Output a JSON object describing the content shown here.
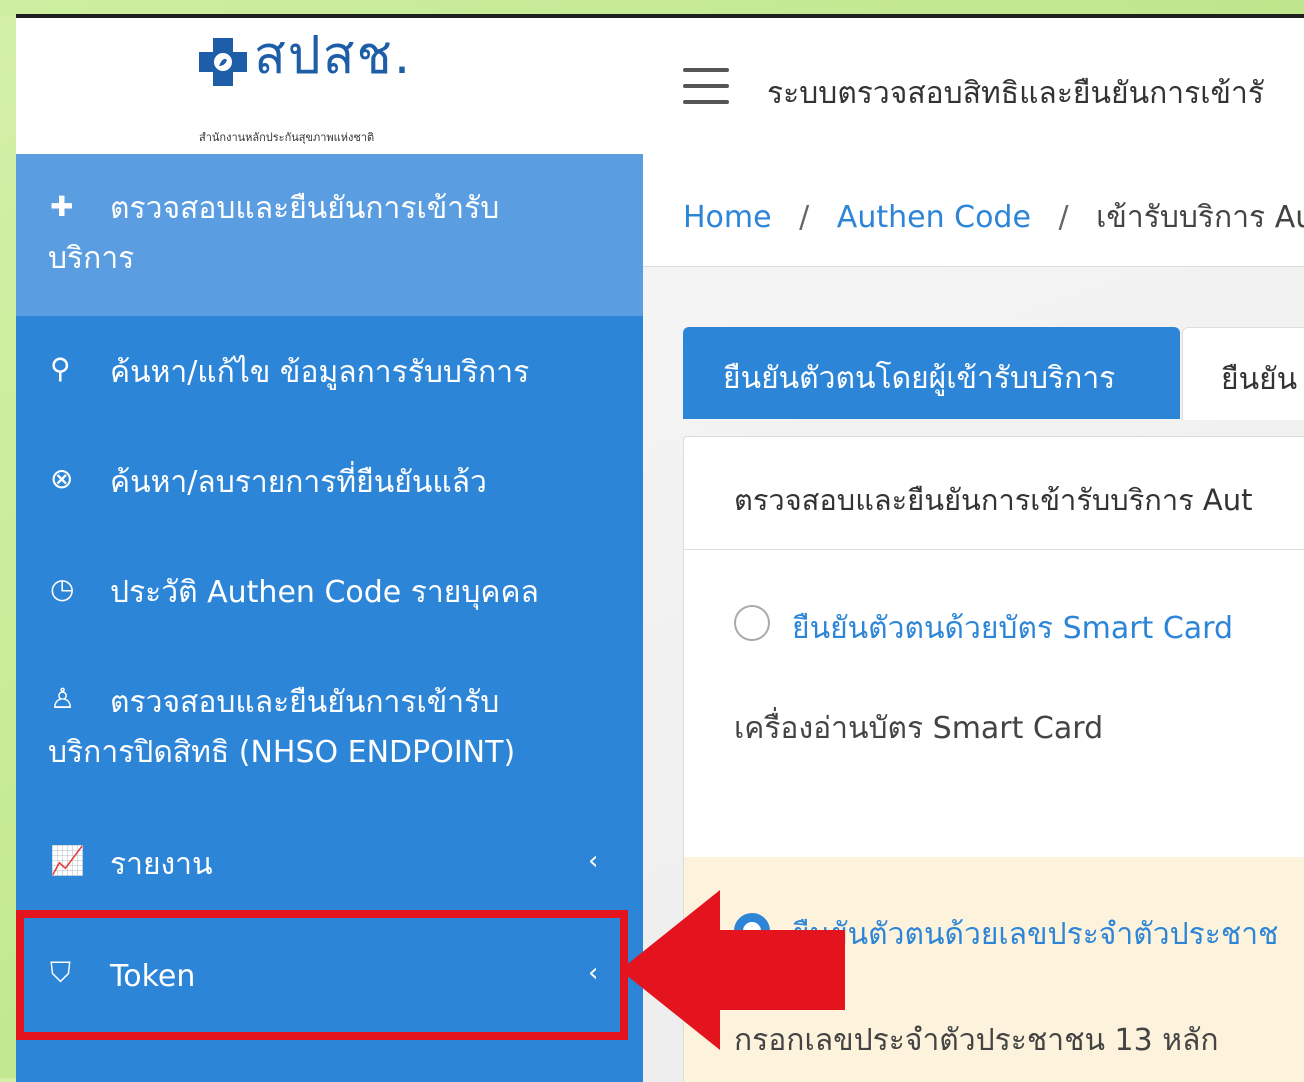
{
  "header": {
    "logo_text": "สปสช.",
    "logo_subtext": "สำนักงานหลักประกันสุขภาพแห่งชาติ",
    "system_title": "ระบบตรวจสอบสิทธิและยืนยันการเข้ารั"
  },
  "sidebar": {
    "items": [
      {
        "icon": "plus-outline-icon",
        "label_line1": "ตรวจสอบและยืนยันการเข้ารับ",
        "label_line2": "บริการ"
      },
      {
        "icon": "search-icon",
        "label": "ค้นหา/แก้ไข ข้อมูลการรับบริการ"
      },
      {
        "icon": "close-circle-icon",
        "label": "ค้นหา/ลบรายการที่ยืนยันแล้ว"
      },
      {
        "icon": "history-icon",
        "label": "ประวัติ Authen Code รายบุคคล"
      },
      {
        "icon": "user-x-icon",
        "label_line1": "ตรวจสอบและยืนยันการเข้ารับ",
        "label_line2": "บริการปิดสิทธิ (NHSO ENDPOINT)"
      },
      {
        "icon": "chart-icon",
        "label": "รายงาน",
        "chevron": "‹"
      },
      {
        "icon": "shield-icon",
        "label": "Token",
        "chevron": "‹"
      }
    ]
  },
  "breadcrumb": {
    "home": "Home",
    "sep": "/",
    "authen": "Authen Code",
    "current": "เข้ารับบริการ Aut"
  },
  "tabs": {
    "active": "ยืนยันตัวตนโดยผู้เข้ารับบริการ",
    "second": "ยืนยัน"
  },
  "card": {
    "header": "ตรวจสอบและยืนยันการเข้ารับบริการ Aut",
    "option1_label": "ยืนยันตัวตนด้วยบัตร Smart Card",
    "reader_label": "เครื่องอ่านบัตร Smart Card",
    "option2_label": "ยืนยันตัวตนด้วยเลขประจำตัวประชาช",
    "id_label": "กรอกเลขประจำตัวประชาชน 13 หลัก"
  },
  "colors": {
    "sidebar_bg": "#2d85d8",
    "sidebar_active": "#5a9de0",
    "annotation_red": "#e3141e"
  }
}
